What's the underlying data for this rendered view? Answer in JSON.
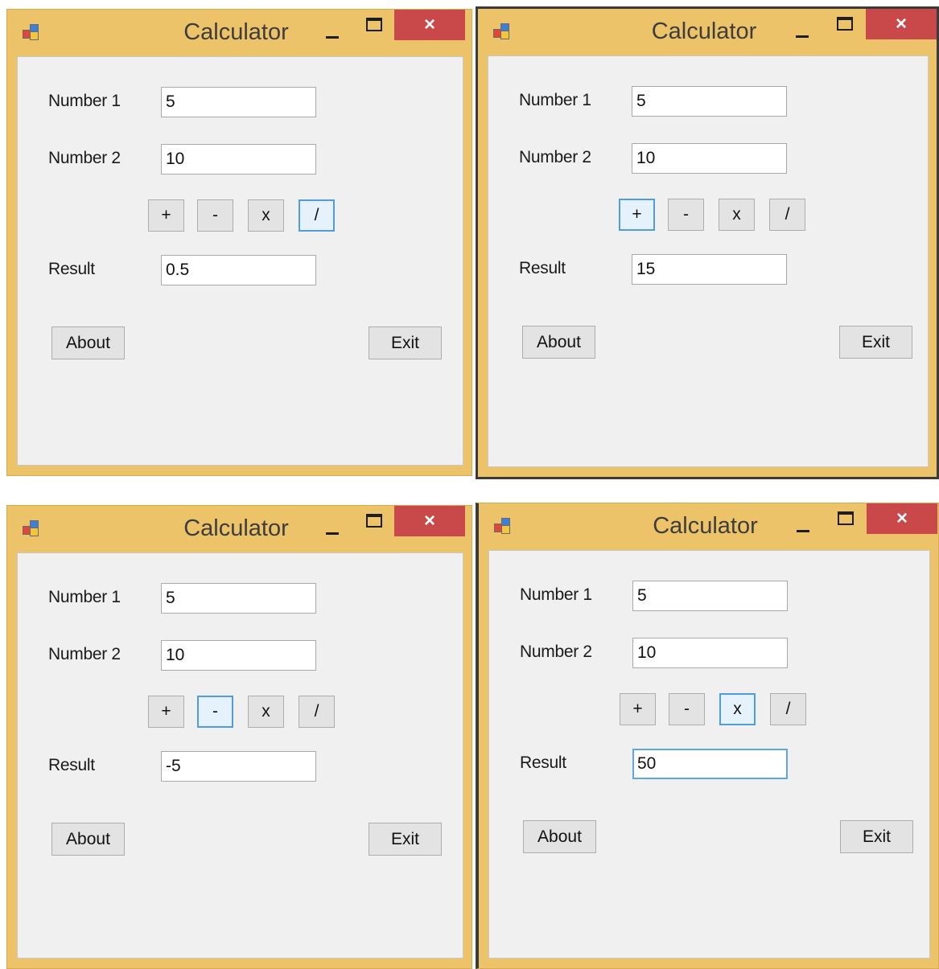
{
  "windows": [
    {
      "title": "Calculator",
      "close_glyph": "×",
      "icon": "app-icon",
      "number1_label": "Number 1",
      "number1_value": "5",
      "number2_label": "Number 2",
      "number2_value": "10",
      "op_plus": "+",
      "op_minus": "-",
      "op_times": "x",
      "op_divide": "/",
      "result_label": "Result",
      "result_value": "0.5",
      "about_label": "About",
      "exit_label": "Exit",
      "highlighted_op": "/"
    },
    {
      "title": "Calculator",
      "close_glyph": "×",
      "icon": "app-icon",
      "number1_label": "Number 1",
      "number1_value": "5",
      "number2_label": "Number 2",
      "number2_value": "10",
      "op_plus": "+",
      "op_minus": "-",
      "op_times": "x",
      "op_divide": "/",
      "result_label": "Result",
      "result_value": "15",
      "about_label": "About",
      "exit_label": "Exit",
      "highlighted_op": "+"
    },
    {
      "title": "Calculator",
      "close_glyph": "×",
      "icon": "app-icon",
      "number1_label": "Number 1",
      "number1_value": "5",
      "number2_label": "Number 2",
      "number2_value": "10",
      "op_plus": "+",
      "op_minus": "-",
      "op_times": "x",
      "op_divide": "/",
      "result_label": "Result",
      "result_value": "-5",
      "about_label": "About",
      "exit_label": "Exit",
      "highlighted_op": "-"
    },
    {
      "title": "Calculator",
      "close_glyph": "×",
      "icon": "app-icon",
      "number1_label": "Number 1",
      "number1_value": "5",
      "number2_label": "Number 2",
      "number2_value": "10",
      "op_plus": "+",
      "op_minus": "-",
      "op_times": "x",
      "op_divide": "/",
      "result_label": "Result",
      "result_value": "50",
      "about_label": "About",
      "exit_label": "Exit",
      "highlighted_op": "x"
    }
  ],
  "colors": {
    "title_bar": "#edc36a",
    "close_button": "#c9484a",
    "client_area": "#f0f0f0",
    "highlight_border": "#4f9de0"
  }
}
